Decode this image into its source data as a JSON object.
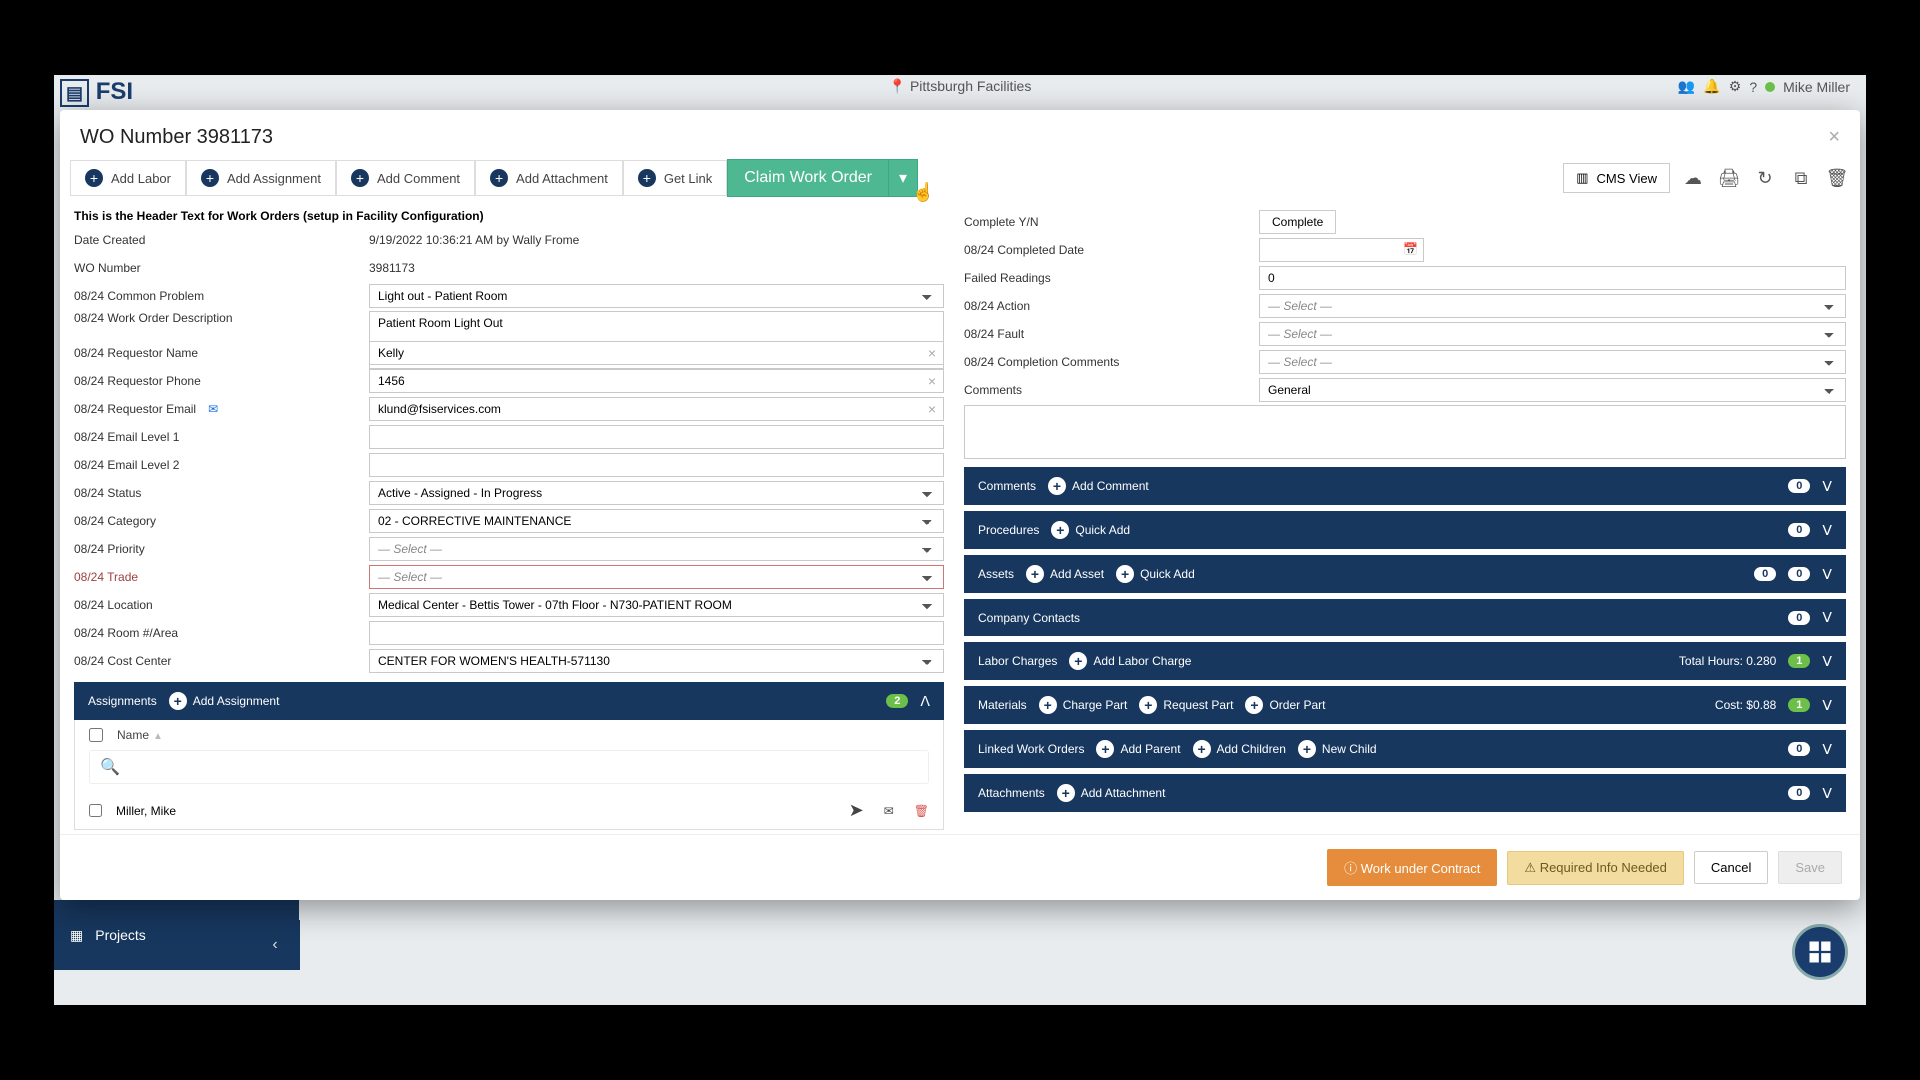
{
  "app": {
    "brand": "FSI",
    "top_center": "Pittsburgh Facilities",
    "top_user": "Mike Miller"
  },
  "sidebar": {
    "projects": "Projects"
  },
  "modal": {
    "title": "WO Number 3981173",
    "close": "×"
  },
  "toolbar": {
    "add_labor": "Add Labor",
    "add_assignment": "Add Assignment",
    "add_comment": "Add Comment",
    "add_attachment": "Add Attachment",
    "get_link": "Get Link",
    "claim": "Claim Work Order",
    "cms_view": "CMS View"
  },
  "form": {
    "header_text": "This is the Header Text for Work Orders (setup in Facility Configuration)",
    "date_created_label": "Date Created",
    "date_created_value": "9/19/2022 10:36:21 AM by Wally Frome",
    "wo_number_label": "WO Number",
    "wo_number_value": "3981173",
    "common_problem_label": "08/24 Common Problem",
    "common_problem_value": "Light out - Patient Room",
    "description_label": "08/24 Work Order Description",
    "description_value": "Patient Room Light Out",
    "req_name_label": "08/24 Requestor Name",
    "req_name_value": "Kelly",
    "req_phone_label": "08/24 Requestor Phone",
    "req_phone_value": "1456",
    "req_email_label": "08/24 Requestor Email",
    "req_email_value": "klund@fsiservices.com",
    "email_l1_label": "08/24 Email Level 1",
    "email_l2_label": "08/24 Email Level 2",
    "status_label": "08/24 Status",
    "status_value": "Active - Assigned - In Progress",
    "category_label": "08/24 Category",
    "category_value": "02 - CORRECTIVE MAINTENANCE",
    "priority_label": "08/24 Priority",
    "priority_value": "— Select —",
    "trade_label": "08/24 Trade",
    "trade_value": "— Select —",
    "location_label": "08/24 Location",
    "location_value": "Medical Center - Bettis Tower - 07th Floor - N730-PATIENT ROOM",
    "room_label": "08/24 Room #/Area",
    "cost_center_label": "08/24 Cost Center",
    "cost_center_value": "CENTER FOR WOMEN'S HEALTH-571130"
  },
  "form_right": {
    "complete_yn_label": "Complete Y/N",
    "complete_btn": "Complete",
    "completed_date_label": "08/24 Completed Date",
    "failed_readings_label": "Failed Readings",
    "failed_readings_value": "0",
    "action_label": "08/24 Action",
    "fault_label": "08/24 Fault",
    "completion_comments_label": "08/24 Completion Comments",
    "comments_label": "Comments",
    "comments_value": "General",
    "select_placeholder": "— Select —"
  },
  "panels": {
    "assignments": {
      "title": "Assignments",
      "add": "Add Assignment",
      "count": "2",
      "name_col": "Name",
      "row1": "Miller, Mike"
    },
    "comments": {
      "title": "Comments",
      "add": "Add Comment",
      "count": "0"
    },
    "procedures": {
      "title": "Procedures",
      "add": "Quick Add",
      "count": "0"
    },
    "assets": {
      "title": "Assets",
      "add1": "Add Asset",
      "add2": "Quick Add",
      "count1": "0",
      "count2": "0"
    },
    "company_contacts": {
      "title": "Company Contacts",
      "count": "0"
    },
    "labor_charges": {
      "title": "Labor Charges",
      "add": "Add Labor Charge",
      "hours_label": "Total Hours: 0.280",
      "count": "1"
    },
    "materials": {
      "title": "Materials",
      "add1": "Charge Part",
      "add2": "Request Part",
      "add3": "Order Part",
      "cost_label": "Cost: $0.88",
      "count": "1"
    },
    "linked": {
      "title": "Linked Work Orders",
      "add1": "Add Parent",
      "add2": "Add Children",
      "add3": "New Child",
      "count": "0"
    },
    "attachments": {
      "title": "Attachments",
      "add": "Add Attachment",
      "count": "0"
    }
  },
  "footer": {
    "contract": "Work under Contract",
    "required": "Required Info Needed",
    "cancel": "Cancel",
    "save": "Save"
  }
}
